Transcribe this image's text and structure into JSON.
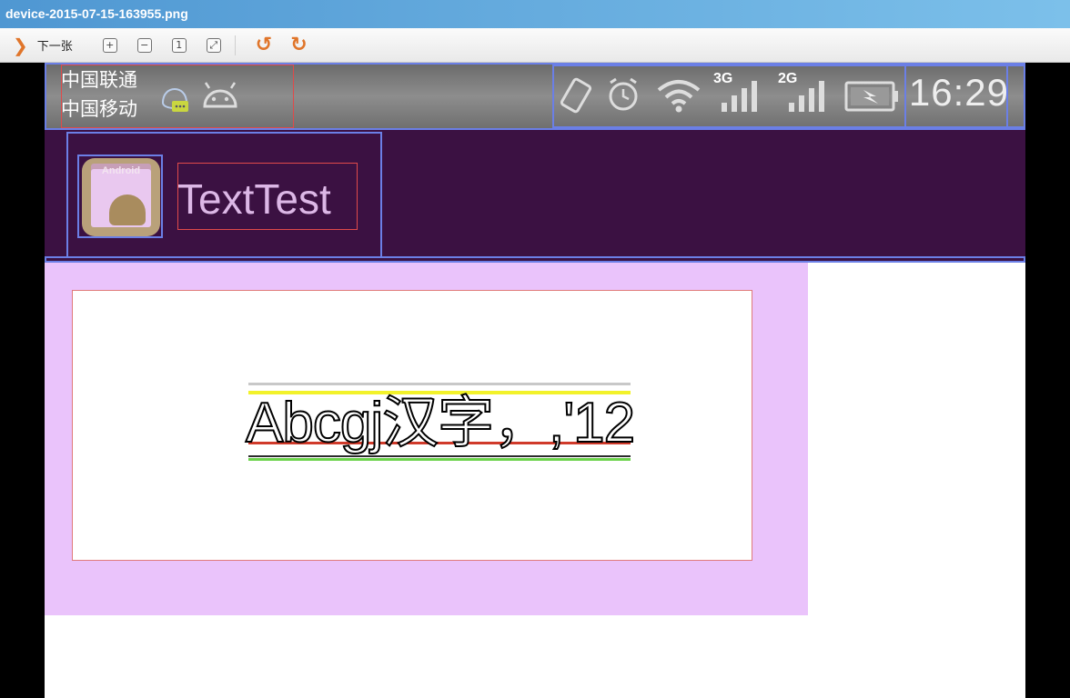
{
  "window": {
    "title": "device-2015-07-15-163955.png"
  },
  "toolbar": {
    "next_label": "下一张",
    "zoom_in_icon": "zoom-in-icon",
    "zoom_out_icon": "zoom-out-icon",
    "actual_size_icon": "actual-size-icon",
    "fit_icon": "fit-window-icon",
    "rotate_left_icon": "rotate-left-icon",
    "rotate_right_icon": "rotate-right-icon",
    "accent_color": "#e0752a"
  },
  "status_bar": {
    "carrier_1": "中国联通",
    "carrier_2": "中国移动",
    "net_1": "3G",
    "net_2": "2G",
    "time": "16:29"
  },
  "action_bar": {
    "app_icon_label": "Android",
    "title": "TextTest",
    "background_color": "#3b1142"
  },
  "content": {
    "sample_text": "Abcgj汉字，,'12",
    "background_color": "#eac3fb"
  }
}
